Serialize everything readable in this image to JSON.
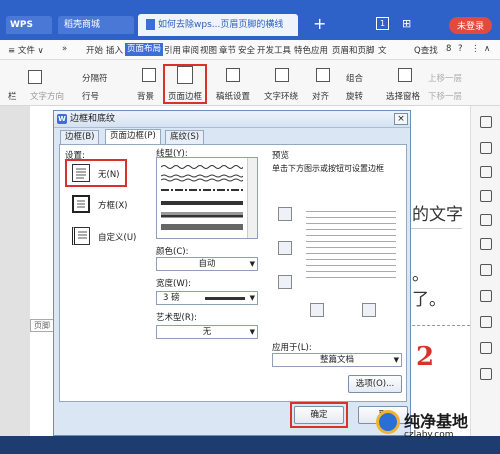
{
  "tabbar": {
    "wps_tab": "WPS",
    "store_tab": "稻壳商城",
    "doc_tab": "如何去除wps...页眉页脚的横线",
    "add_tab": "+",
    "window_badge": "1",
    "login_button": "未登录"
  },
  "menubar": {
    "items": [
      "≡ 文件 ∨",
      "»",
      "开始",
      "插入",
      "页面布局",
      "引用",
      "审阅",
      "视图",
      "章节",
      "安全",
      "开发工具",
      "特色应用",
      "页眉和页脚",
      "文"
    ],
    "active_index": 4,
    "find_label": "Q查找",
    "right_icons": [
      "8",
      "?",
      "⋮",
      "∧"
    ]
  },
  "ribbon": {
    "left_cut": "栏",
    "text_direction": "文字方向",
    "separator": "分隔符",
    "line_number": "行号",
    "background": "背景",
    "page_border": "页面边框",
    "manuscript": "稿纸设置",
    "text_wrap": "文字环绕",
    "align": "对齐",
    "group": "组合",
    "rotate": "旋转",
    "select_pane": "选择窗格",
    "up_layer": "上移一层",
    "down_layer": "下移一层"
  },
  "document": {
    "line1": "的文字",
    "line2": "。",
    "line3": "了。",
    "footer_label": "页脚",
    "step_number": "2"
  },
  "dialog": {
    "title": "边框和底纹",
    "close": "×",
    "tabs": [
      "边框(B)",
      "页面边框(P)",
      "底纹(S)"
    ],
    "selected_tab": 1,
    "settings_label": "设置:",
    "settings": [
      {
        "label": "无(N)",
        "icon": "none-border-icon"
      },
      {
        "label": "方框(X)",
        "icon": "box-border-icon"
      },
      {
        "label": "自定义(U)",
        "icon": "custom-border-icon"
      }
    ],
    "line_style_label": "线型(Y):",
    "color_label": "颜色(C):",
    "color_value": "自动",
    "width_label": "宽度(W):",
    "width_value": "3 磅",
    "art_label": "艺术型(R):",
    "art_value": "无",
    "preview_label": "预览",
    "preview_hint": "单击下方图示或按钮可设置边框",
    "apply_to_label": "应用于(L):",
    "apply_to_value": "整篇文档",
    "options_button": "选项(O)...",
    "ok_button": "确定",
    "cancel_button": "取"
  },
  "watermark": {
    "name": "纯净基地",
    "url": "czlaby.com"
  },
  "colors": {
    "title_bar": "#2f62c9",
    "highlight": "#d8322b",
    "dialog_bg": "#dbe6f4"
  }
}
